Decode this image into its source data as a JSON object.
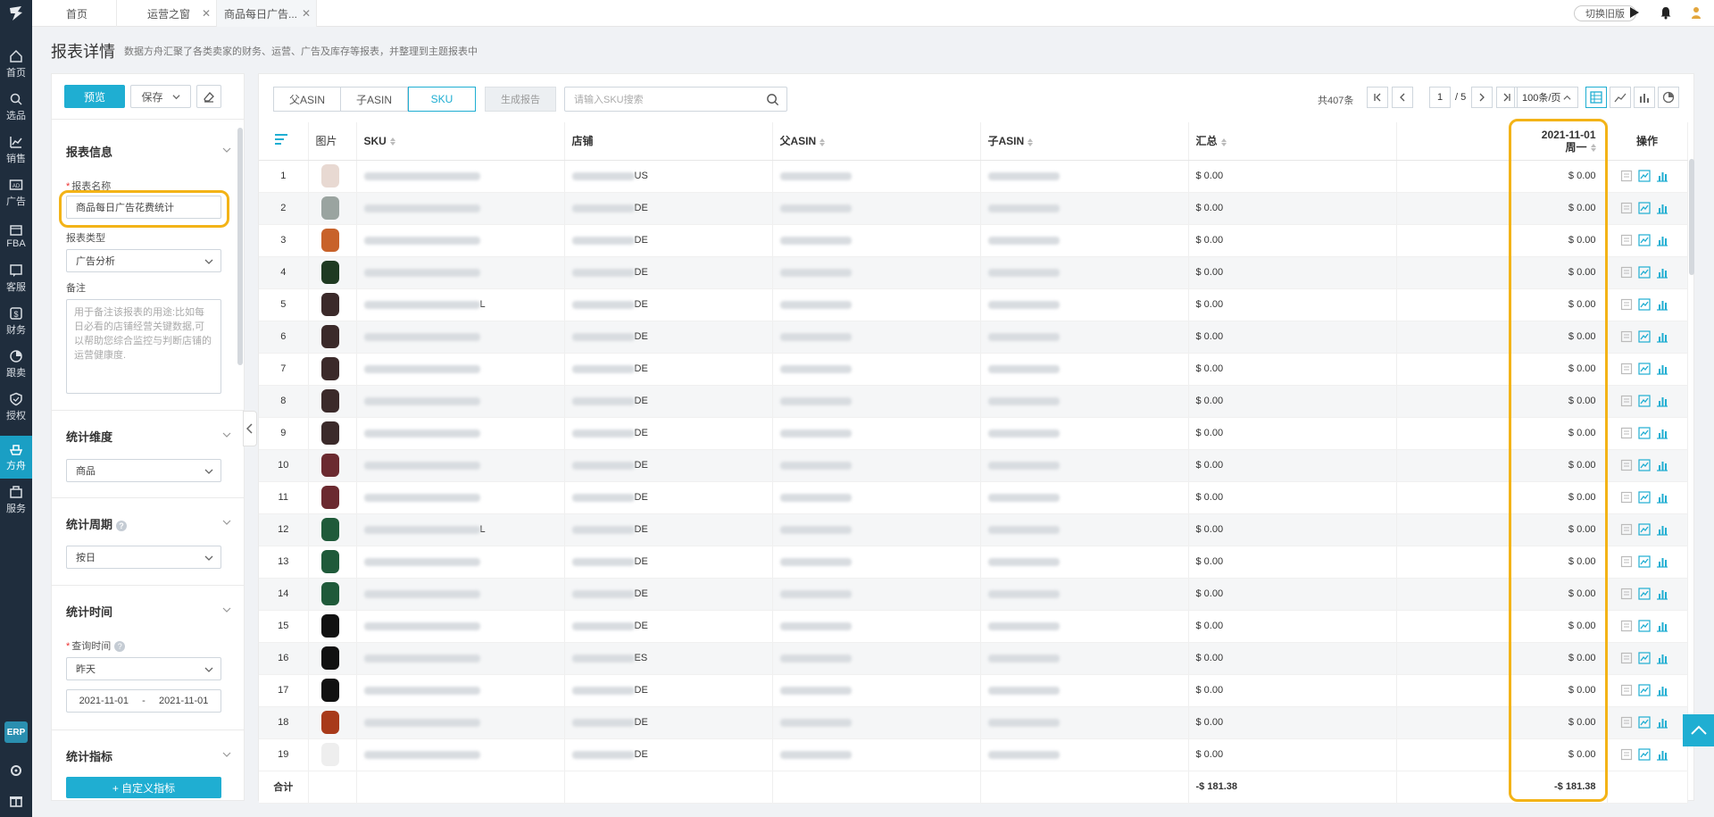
{
  "nav": {
    "items": [
      {
        "label": "首页",
        "icon": "home-icon"
      },
      {
        "label": "选品",
        "icon": "search-icon"
      },
      {
        "label": "销售",
        "icon": "chart-line-icon"
      },
      {
        "label": "广告",
        "icon": "ad-icon"
      },
      {
        "label": "FBA",
        "icon": "box-icon"
      },
      {
        "label": "客服",
        "icon": "message-icon"
      },
      {
        "label": "财务",
        "icon": "dollar-icon"
      },
      {
        "label": "跟卖",
        "icon": "pie-icon"
      },
      {
        "label": "授权",
        "icon": "shield-icon"
      },
      {
        "label": "方舟",
        "icon": "ark-icon"
      },
      {
        "label": "服务",
        "icon": "service-icon"
      }
    ],
    "active_index": 9,
    "erp_label": "ERP"
  },
  "tabs": [
    {
      "label": "首页",
      "closable": false
    },
    {
      "label": "运营之窗",
      "closable": true
    },
    {
      "label": "商品每日广告...",
      "closable": true,
      "active": true
    }
  ],
  "topbar": {
    "old_version": "切换旧版"
  },
  "page": {
    "title": "报表详情",
    "description": "数据方舟汇聚了各类卖家的财务、运营、广告及库存等报表，并整理到主题报表中"
  },
  "config": {
    "preview": "预览",
    "save": "保存",
    "report_info_title": "报表信息",
    "name_label": "报表名称",
    "name_value": "商品每日广告花费统计",
    "type_label": "报表类型",
    "type_value": "广告分析",
    "note_label": "备注",
    "note_placeholder": "用于备注该报表的用途:比如每日必看的店铺经营关键数据,可以帮助您综合监控与判断店铺的运营健康度.",
    "dimension_title": "统计维度",
    "dimension_value": "商品",
    "period_title": "统计周期",
    "period_value": "按日",
    "time_title": "统计时间",
    "query_time_label": "查询时间",
    "query_time_value": "昨天",
    "date_start": "2021-11-01",
    "date_sep": "-",
    "date_end": "2021-11-01",
    "metrics_title": "统计指标",
    "custom_metric": "+ 自定义指标"
  },
  "toolbar": {
    "segments": [
      "父ASIN",
      "子ASIN",
      "SKU"
    ],
    "active_segment": 2,
    "generate_report": "生成报告",
    "search_placeholder": "请输入SKU搜索",
    "total": "共407条",
    "current_page": "1",
    "page_total": "/ 5",
    "page_size": "100条/页"
  },
  "table": {
    "headers": {
      "image": "图片",
      "sku": "SKU",
      "store": "店铺",
      "parent_asin": "父ASIN",
      "child_asin": "子ASIN",
      "total": "汇总",
      "date": "2021-11-01",
      "weekday": "周一",
      "actions": "操作"
    },
    "rows": [
      {
        "n": "1",
        "store_suffix": "US",
        "sku_suffix": "",
        "total": "$ 0.00",
        "day": "$ 0.00",
        "color": "#e8d9d2"
      },
      {
        "n": "2",
        "store_suffix": "DE",
        "sku_suffix": "",
        "total": "$ 0.00",
        "day": "$ 0.00",
        "color": "#9aa4a0"
      },
      {
        "n": "3",
        "store_suffix": "DE",
        "sku_suffix": "",
        "total": "$ 0.00",
        "day": "$ 0.00",
        "color": "#c8622a"
      },
      {
        "n": "4",
        "store_suffix": "DE",
        "sku_suffix": "",
        "total": "$ 0.00",
        "day": "$ 0.00",
        "color": "#1f3a22"
      },
      {
        "n": "5",
        "store_suffix": "DE",
        "sku_suffix": "L",
        "total": "$ 0.00",
        "day": "$ 0.00",
        "color": "#3b2a2a"
      },
      {
        "n": "6",
        "store_suffix": "DE",
        "sku_suffix": "",
        "total": "$ 0.00",
        "day": "$ 0.00",
        "color": "#3b2a2a"
      },
      {
        "n": "7",
        "store_suffix": "DE",
        "sku_suffix": "",
        "total": "$ 0.00",
        "day": "$ 0.00",
        "color": "#3b2a2a"
      },
      {
        "n": "8",
        "store_suffix": "DE",
        "sku_suffix": "",
        "total": "$ 0.00",
        "day": "$ 0.00",
        "color": "#3b2a2a"
      },
      {
        "n": "9",
        "store_suffix": "DE",
        "sku_suffix": "",
        "total": "$ 0.00",
        "day": "$ 0.00",
        "color": "#3b2a2a"
      },
      {
        "n": "10",
        "store_suffix": "DE",
        "sku_suffix": "",
        "total": "$ 0.00",
        "day": "$ 0.00",
        "color": "#6b2a30"
      },
      {
        "n": "11",
        "store_suffix": "DE",
        "sku_suffix": "",
        "total": "$ 0.00",
        "day": "$ 0.00",
        "color": "#6b2a30"
      },
      {
        "n": "12",
        "store_suffix": "DE",
        "sku_suffix": "L",
        "total": "$ 0.00",
        "day": "$ 0.00",
        "color": "#1f5a3a"
      },
      {
        "n": "13",
        "store_suffix": "DE",
        "sku_suffix": "",
        "total": "$ 0.00",
        "day": "$ 0.00",
        "color": "#1f5a3a"
      },
      {
        "n": "14",
        "store_suffix": "DE",
        "sku_suffix": "",
        "total": "$ 0.00",
        "day": "$ 0.00",
        "color": "#1f5a3a"
      },
      {
        "n": "15",
        "store_suffix": "DE",
        "sku_suffix": "",
        "total": "$ 0.00",
        "day": "$ 0.00",
        "color": "#111111"
      },
      {
        "n": "16",
        "store_suffix": "ES",
        "sku_suffix": "",
        "total": "$ 0.00",
        "day": "$ 0.00",
        "color": "#111111"
      },
      {
        "n": "17",
        "store_suffix": "DE",
        "sku_suffix": "",
        "total": "$ 0.00",
        "day": "$ 0.00",
        "color": "#111111"
      },
      {
        "n": "18",
        "store_suffix": "DE",
        "sku_suffix": "",
        "total": "$ 0.00",
        "day": "$ 0.00",
        "color": "#a83a1a"
      },
      {
        "n": "19",
        "store_suffix": "DE",
        "sku_suffix": "",
        "total": "$ 0.00",
        "day": "$ 0.00",
        "color": "#eeeeee"
      }
    ],
    "footer": {
      "label": "合计",
      "total": "-$ 181.38",
      "day": "-$ 181.38"
    }
  },
  "colors": {
    "accent": "#1faed2",
    "nav_bg": "#1f2d3d",
    "highlight": "#f3b317"
  }
}
